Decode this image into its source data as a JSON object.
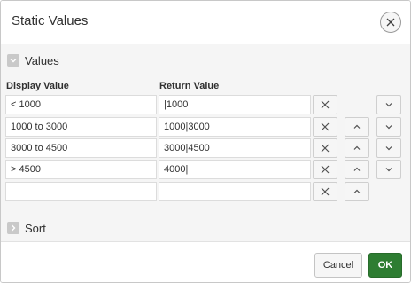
{
  "dialog": {
    "title": "Static Values"
  },
  "values_region": {
    "label": "Values"
  },
  "sort_region": {
    "label": "Sort"
  },
  "columns": {
    "display": "Display Value",
    "return": "Return Value"
  },
  "rows": [
    {
      "display": "< 1000",
      "return": "|1000"
    },
    {
      "display": "1000 to 3000",
      "return": "1000|3000"
    },
    {
      "display": "3000 to 4500",
      "return": "3000|4500"
    },
    {
      "display": "> 4500",
      "return": "4000|"
    },
    {
      "display": "",
      "return": ""
    }
  ],
  "footer": {
    "cancel_label": "Cancel",
    "ok_label": "OK"
  },
  "colors": {
    "ok_button": "#2e7d32",
    "body_bg": "#f5f5f5"
  },
  "icons": {
    "close": "close-icon",
    "delete": "x-icon",
    "up": "chevron-up-icon",
    "down": "chevron-down-icon"
  }
}
